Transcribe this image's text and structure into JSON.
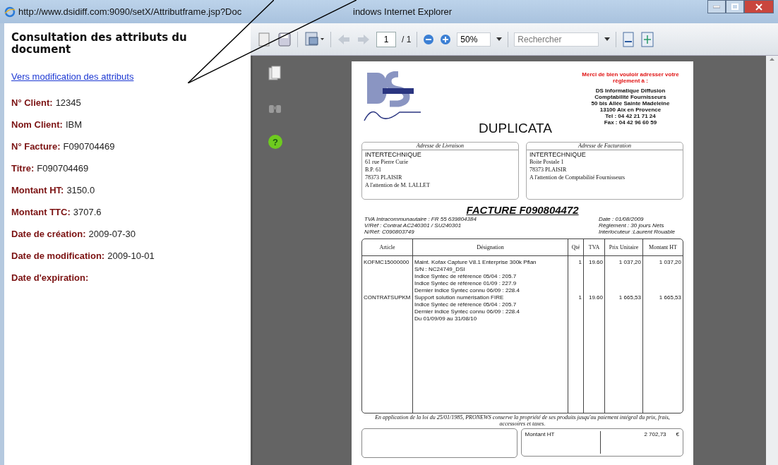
{
  "window": {
    "title_start": "http://www.dsidiff.com:9090/setX/Attributframe.jsp?Doc",
    "title_end": "indows Internet Explorer"
  },
  "attributes_panel": {
    "heading": "Consultation des attributs du document",
    "link": "Vers modification des attributs",
    "fields": [
      {
        "label": "N° Client:",
        "value": "12345"
      },
      {
        "label": "Nom Client:",
        "value": "IBM"
      },
      {
        "label": "N° Facture:",
        "value": "F090704469"
      },
      {
        "label": "Titre:",
        "value": "F090704469"
      },
      {
        "label": "Montant HT:",
        "value": "3150.0"
      },
      {
        "label": "Montant TTC:",
        "value": "3707.6"
      },
      {
        "label": "Date de création:",
        "value": "2009-07-30"
      },
      {
        "label": "Date de modification:",
        "value": "2009-10-01"
      },
      {
        "label": "Date d'expiration:"
      }
    ]
  },
  "toolbar": {
    "page_current": "1",
    "page_total": "/ 1",
    "zoom": "50%",
    "search": {
      "placeholder": "Rechercher"
    },
    "help_mark": "?"
  },
  "invoice": {
    "notice": "Merci de bien vouloir adresser votre règlement à :",
    "company": [
      "DS Informatique Diffusion",
      "Comptabilité Fournisseurs",
      "50 bis Allée Sainte Madeleine",
      "13100 Aix en Provence",
      "Tel : 04 42 21 71 24",
      "Fax : 04 42 96 60 59"
    ],
    "stamp": "DUPLICATA",
    "addresses": [
      {
        "caption": "Adresse de Livraison",
        "name": "INTERTECHNIQUE",
        "lines": [
          "61 rue Pierre Curie",
          "B.P. 61",
          "78373 PLAISIR",
          "A l'attention de M. LALLET"
        ]
      },
      {
        "caption": "Adresse de Facturation",
        "name": "INTERTECHNIQUE",
        "lines": [
          "Boite Postale 1",
          "78373 PLAISIR",
          "A l'attention de Comptabilité Fournisseurs"
        ]
      }
    ],
    "title": "FACTURE F090804472",
    "info_left": [
      "TVA Intracommunautaire : FR 55 639804384",
      "V/Réf : Contrat AC240301 / SU240301",
      "N/Réf: C090803749"
    ],
    "info_right": [
      "Date : 01/08/2009",
      "Réglement : 30 jours Nets",
      "Interlocuteur :Laurent Rouable"
    ],
    "columns": [
      "Article",
      "Désignation",
      "Qté",
      "TVA",
      "Prix Unitaire",
      "Montant HT"
    ],
    "rows": [
      {
        "article": "KOFMC15000000",
        "designation": [
          "Maint. Kofax Capture V8.1 Enterprise 300k Pflan",
          "S/N : NC24749_DSI",
          "Indice Syntec de référence 05/04 : 205.7",
          "Indice Syntec de référence 01/09 : 227.9",
          "Dernier indice Syntec connu 06/09 : 228.4"
        ],
        "qty": "1",
        "tva": "19.60",
        "unit": "1 037,20",
        "total": "1 037,20"
      },
      {
        "article": "CONTRATSUPKM",
        "designation": [
          "Support solution numérisation FIRE",
          "Indice Syntec de référence 05/04 : 205.7",
          "Dernier indice Syntec connu 06/09 : 228.4",
          "Du 01/09/09 au 31/08/10"
        ],
        "qty": "1",
        "tva": "19.60",
        "unit": "1 665,53",
        "total": "1 665,53"
      }
    ],
    "legal": "En application de la loi du 25/01/1985, PRONEWS conserve la propriété de ses produits jusqu'au paiement intégral du prix, frais, accessoires et taxes.",
    "totals": [
      {
        "label": "Montant HT",
        "value": "2 702,73",
        "currency": "€"
      }
    ]
  }
}
